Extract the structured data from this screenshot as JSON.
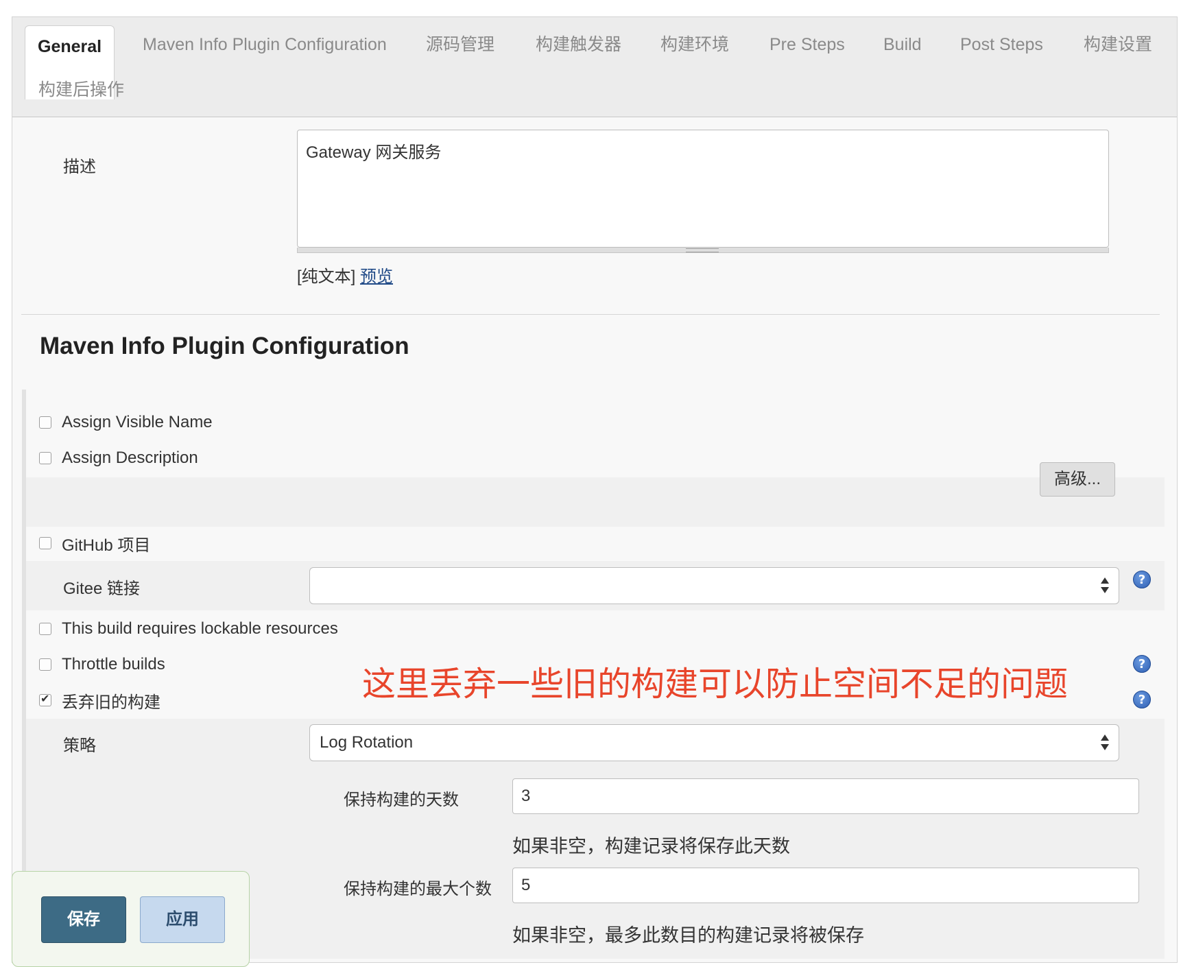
{
  "tabs": [
    {
      "label": "General",
      "active": true
    },
    {
      "label": "Maven Info Plugin Configuration"
    },
    {
      "label": "源码管理"
    },
    {
      "label": "构建触发器"
    },
    {
      "label": "构建环境"
    },
    {
      "label": "Pre Steps"
    },
    {
      "label": "Build"
    },
    {
      "label": "Post Steps"
    },
    {
      "label": "构建设置"
    },
    {
      "label": "构建后操作"
    }
  ],
  "description": {
    "label": "描述",
    "value": "Gateway 网关服务",
    "format_prefix": "[纯文本]",
    "preview_link": "预览"
  },
  "maven_section": {
    "title": "Maven Info Plugin Configuration",
    "assign_visible_name": "Assign Visible Name",
    "assign_description": "Assign Description",
    "advanced_button": "高级..."
  },
  "options": {
    "github_project": "GitHub 项目",
    "gitee_label": "Gitee 链接",
    "gitee_value": "",
    "lockable": "This build requires lockable resources",
    "throttle": "Throttle builds",
    "discard_old": "丢弃旧的构建",
    "discard_old_checked": true
  },
  "annotation": "这里丢弃一些旧的构建可以防止空间不足的问题",
  "strategy": {
    "label": "策略",
    "value": "Log Rotation",
    "days_label": "保持构建的天数",
    "days_value": "3",
    "days_hint": "如果非空，构建记录将保存此天数",
    "max_label": "保持构建的最大个数",
    "max_value": "5",
    "max_hint": "如果非空，最多此数目的构建记录将被保存"
  },
  "footer": {
    "save": "保存",
    "apply": "应用"
  },
  "help_glyph": "?",
  "colors": {
    "annotation": "#e8452b",
    "save_button": "#3d6b85",
    "apply_button": "#c6d9ee",
    "help_icon": "#2f5fb3"
  }
}
